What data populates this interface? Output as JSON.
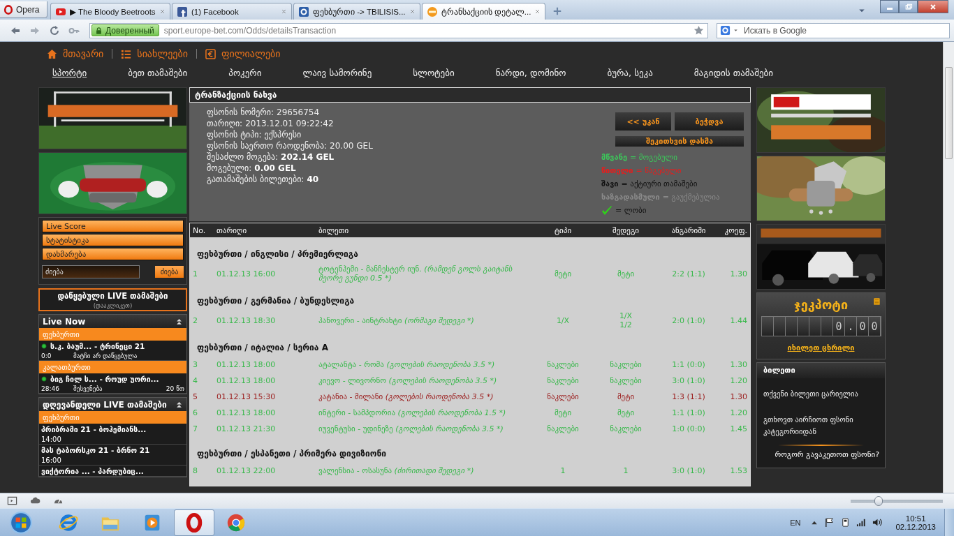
{
  "browser": {
    "menu_label": "Opera",
    "tabs": [
      {
        "kind": "video",
        "title": "▶ The Bloody Beetroots",
        "selected": false
      },
      {
        "kind": "social",
        "title": "(1) Facebook",
        "selected": false
      },
      {
        "kind": "letter",
        "title": "ფეხბურთი -> TBILISIS...",
        "selected": false
      },
      {
        "kind": "site",
        "title": "ტრანსაქციის დეტალ...",
        "selected": true
      }
    ],
    "address": {
      "secure_label": "Доверенный",
      "url": "sport.europe-bet.com/Odds/detailsTransaction"
    },
    "search": {
      "placeholder": "Искать в Google"
    }
  },
  "top_links": [
    {
      "kind": "home",
      "label": "მთავარი"
    },
    {
      "kind": "list",
      "label": "სიახლეები"
    },
    {
      "kind": "money",
      "label": "ფილიალები"
    }
  ],
  "main_nav": [
    {
      "label": "სპორტი",
      "selected": true
    },
    {
      "label": "ბეთ თამაშები",
      "selected": false
    },
    {
      "label": "პოკერი",
      "selected": false
    },
    {
      "label": "ლაივ სამორინე",
      "selected": false
    },
    {
      "label": "სლოტები",
      "selected": false
    },
    {
      "label": "ნარდი, დომინო",
      "selected": false
    },
    {
      "label": "ბურა, სეკა",
      "selected": false
    },
    {
      "label": "მაგიდის თამაშები",
      "selected": false
    }
  ],
  "left": {
    "banners": [
      {
        "kind": "picture"
      },
      {
        "kind": "picture"
      }
    ],
    "menu_buttons": [
      "Live Score",
      "სტატისტიკა",
      "დახმარება"
    ],
    "search": {
      "placeholder": "ძიება",
      "button": "ძიება"
    },
    "started_live": {
      "title": "დაწყებული LIVE თამაშები",
      "subtitle": "(დააკლიკეთ)"
    },
    "live_now": {
      "title": "Live Now",
      "groups": [
        {
          "sport": "ფეხბურთი",
          "matches": [
            {
              "teams": "ს.კ. ბაუმ... - ტრინეცი 21",
              "score": "0:0",
              "status": "მატჩი არ დაწყებულა"
            }
          ]
        },
        {
          "sport": "კალათბურთი",
          "matches": [
            {
              "teams": "ბიგ ჩილ ს... - როუდ უორი...",
              "score": "28:46",
              "status": "შესვენება",
              "minute": "20 წთ"
            }
          ]
        }
      ]
    },
    "today_live": {
      "title": "დღევანდელი LIVE თამაშები",
      "groups": [
        {
          "sport": "ფეხბურთი",
          "matches": [
            {
              "teams": "პრიბრამი 21 - ბოჰემიანს...",
              "time": "14:00"
            },
            {
              "teams": "მას ტაბორსკო 21 - ბრნო 21",
              "time": "16:00"
            },
            {
              "teams": "ვიქტორია ... - პარდუბიც..."
            }
          ]
        }
      ]
    }
  },
  "transaction": {
    "title": "ტრანზაქციის ნახვა",
    "info": [
      {
        "label": "ფსონის ნომერი:",
        "value": "29656754",
        "bold": false
      },
      {
        "label": "თარიღი:",
        "value": "2013.12.01 09:22:42",
        "bold": false
      },
      {
        "label": "ფსონის ტიპი:",
        "value": "ექსპრესი",
        "bold": false
      },
      {
        "label": "ფსონის საერთო რაოდენობა:",
        "value": "20.00 GEL",
        "bold": false
      },
      {
        "label": "შესაძლო მოგება:",
        "value": "202.14 GEL",
        "bold": true
      },
      {
        "label": "მოგებული:",
        "value": "0.00 GEL",
        "bold": true
      },
      {
        "label": "გათამაშების ბილეთები:",
        "value": "40",
        "bold": true
      }
    ],
    "buttons": [
      "<< უკან",
      "ბეჭდვა"
    ],
    "wide_button": "შეკითხვის დასმა",
    "legend": [
      {
        "kind": "text",
        "term": "მწვანე",
        "text": "= მოგებული",
        "color": "#3cc85a"
      },
      {
        "kind": "text",
        "term": "წითელი",
        "text": "= წაგებული",
        "color": "#e81c1c"
      },
      {
        "kind": "text",
        "term": "შავი",
        "text": "= აქტიური თამაშები",
        "color": "#111111"
      },
      {
        "kind": "text",
        "term": "ხაზგადასმული",
        "text": "= გაუქმებულია",
        "color": "#8a8a8a"
      },
      {
        "kind": "check",
        "text": "= ლობი"
      }
    ]
  },
  "table": {
    "columns": [
      "No.",
      "თარიღი",
      "ბილეთი",
      "ტიპი",
      "შედეგი",
      "ანგარიში",
      "კოეფ."
    ],
    "groups": [
      {
        "title": "ფეხბურთი / ინგლისი / პრემიერლიგა",
        "rows": [
          {
            "no": "1",
            "date": "01.12.13 16:00",
            "match": "ტოტენჰემი - მანჩესტერ იუნ.",
            "note": "(რამდენ გოლს გაიტანს მეორე გუნდი 0.5 *)",
            "type": "მეტი",
            "result": [
              "მეტი"
            ],
            "score": "2:2 (1:1)",
            "odds": "1.30",
            "won": true
          }
        ]
      },
      {
        "title": "ფეხბურთი / გერმანია / ბუნდესლიგა",
        "rows": [
          {
            "no": "2",
            "date": "01.12.13 18:30",
            "match": "ჰანოვერი - აინტრახტი",
            "note": "(ორმაგი შედეგი *)",
            "type": "1/X",
            "result": [
              "1/X",
              "1/2"
            ],
            "score": "2:0 (1:0)",
            "odds": "1.44",
            "won": true
          }
        ]
      },
      {
        "title": "ფეხბურთი / იტალია / სერია A",
        "rows": [
          {
            "no": "3",
            "date": "01.12.13 18:00",
            "match": "ატალანტა - რომა",
            "note": "(გოლების რაოდენობა 3.5 *)",
            "type": "ნაკლები",
            "result": [
              "ნაკლები"
            ],
            "score": "1:1 (0:0)",
            "odds": "1.30",
            "won": true
          },
          {
            "no": "4",
            "date": "01.12.13 18:00",
            "match": "კიევო - ლივორნო",
            "note": "(გოლების რაოდენობა 3.5 *)",
            "type": "ნაკლები",
            "result": [
              "ნაკლები"
            ],
            "score": "3:0 (1:0)",
            "odds": "1.20",
            "won": true
          },
          {
            "no": "5",
            "date": "01.12.13 15:30",
            "match": "კატანია - მილანი",
            "note": "(გოლების რაოდენობა 3.5 *)",
            "type": "ნაკლები",
            "result": [
              "მეტი"
            ],
            "score": "1:3 (1:1)",
            "odds": "1.30",
            "won": false
          },
          {
            "no": "6",
            "date": "01.12.13 18:00",
            "match": "ინტერი - სამპდორია",
            "note": "(გოლების რაოდენობა 1.5 *)",
            "type": "მეტი",
            "result": [
              "მეტი"
            ],
            "score": "1:1 (1:0)",
            "odds": "1.20",
            "won": true
          },
          {
            "no": "7",
            "date": "01.12.13 21:30",
            "match": "იუვენტუსი - უდინეზე",
            "note": "(გოლების რაოდენობა 3.5 *)",
            "type": "ნაკლები",
            "result": [
              "ნაკლები"
            ],
            "score": "1:0 (0:0)",
            "odds": "1.45",
            "won": true
          }
        ]
      },
      {
        "title": "ფეხბურთი / ესპანეთი / პრიმერა დივიზიონი",
        "rows": [
          {
            "no": "8",
            "date": "01.12.13 22:00",
            "match": "ვალენსია - ოსასუნა",
            "note": "(ძირითადი შედეგი *)",
            "type": "1",
            "result": [
              "1"
            ],
            "score": "3:0 (1:0)",
            "odds": "1.53",
            "won": true
          }
        ]
      }
    ]
  },
  "right": {
    "banners": [
      {
        "kind": "picture"
      },
      {
        "kind": "picture"
      },
      {
        "kind": "picture"
      }
    ],
    "jackpot": {
      "title": "ჯეკპოტი",
      "value": "0.00",
      "link": "იხილეთ ცხრილი"
    },
    "ticket": {
      "title": "ბილეთი",
      "message": "თქვენი ბილეთი ცარიელია",
      "hint": "გთხოვთ აირჩიოთ ფსონი კატეგორიიდან",
      "link": "როგორ გავაკეთოთ ფსონი?"
    }
  },
  "status_bar": {
    "zoom": {
      "level": 0.28
    }
  },
  "taskbar": {
    "apps": [
      {
        "kind": "globe",
        "selected": false
      },
      {
        "kind": "folder",
        "selected": false
      },
      {
        "kind": "player",
        "selected": false
      },
      {
        "kind": "ring",
        "selected": true
      },
      {
        "kind": "wheel",
        "selected": false
      }
    ],
    "language": "EN",
    "time": "10:51",
    "date": "02.12.2013"
  }
}
